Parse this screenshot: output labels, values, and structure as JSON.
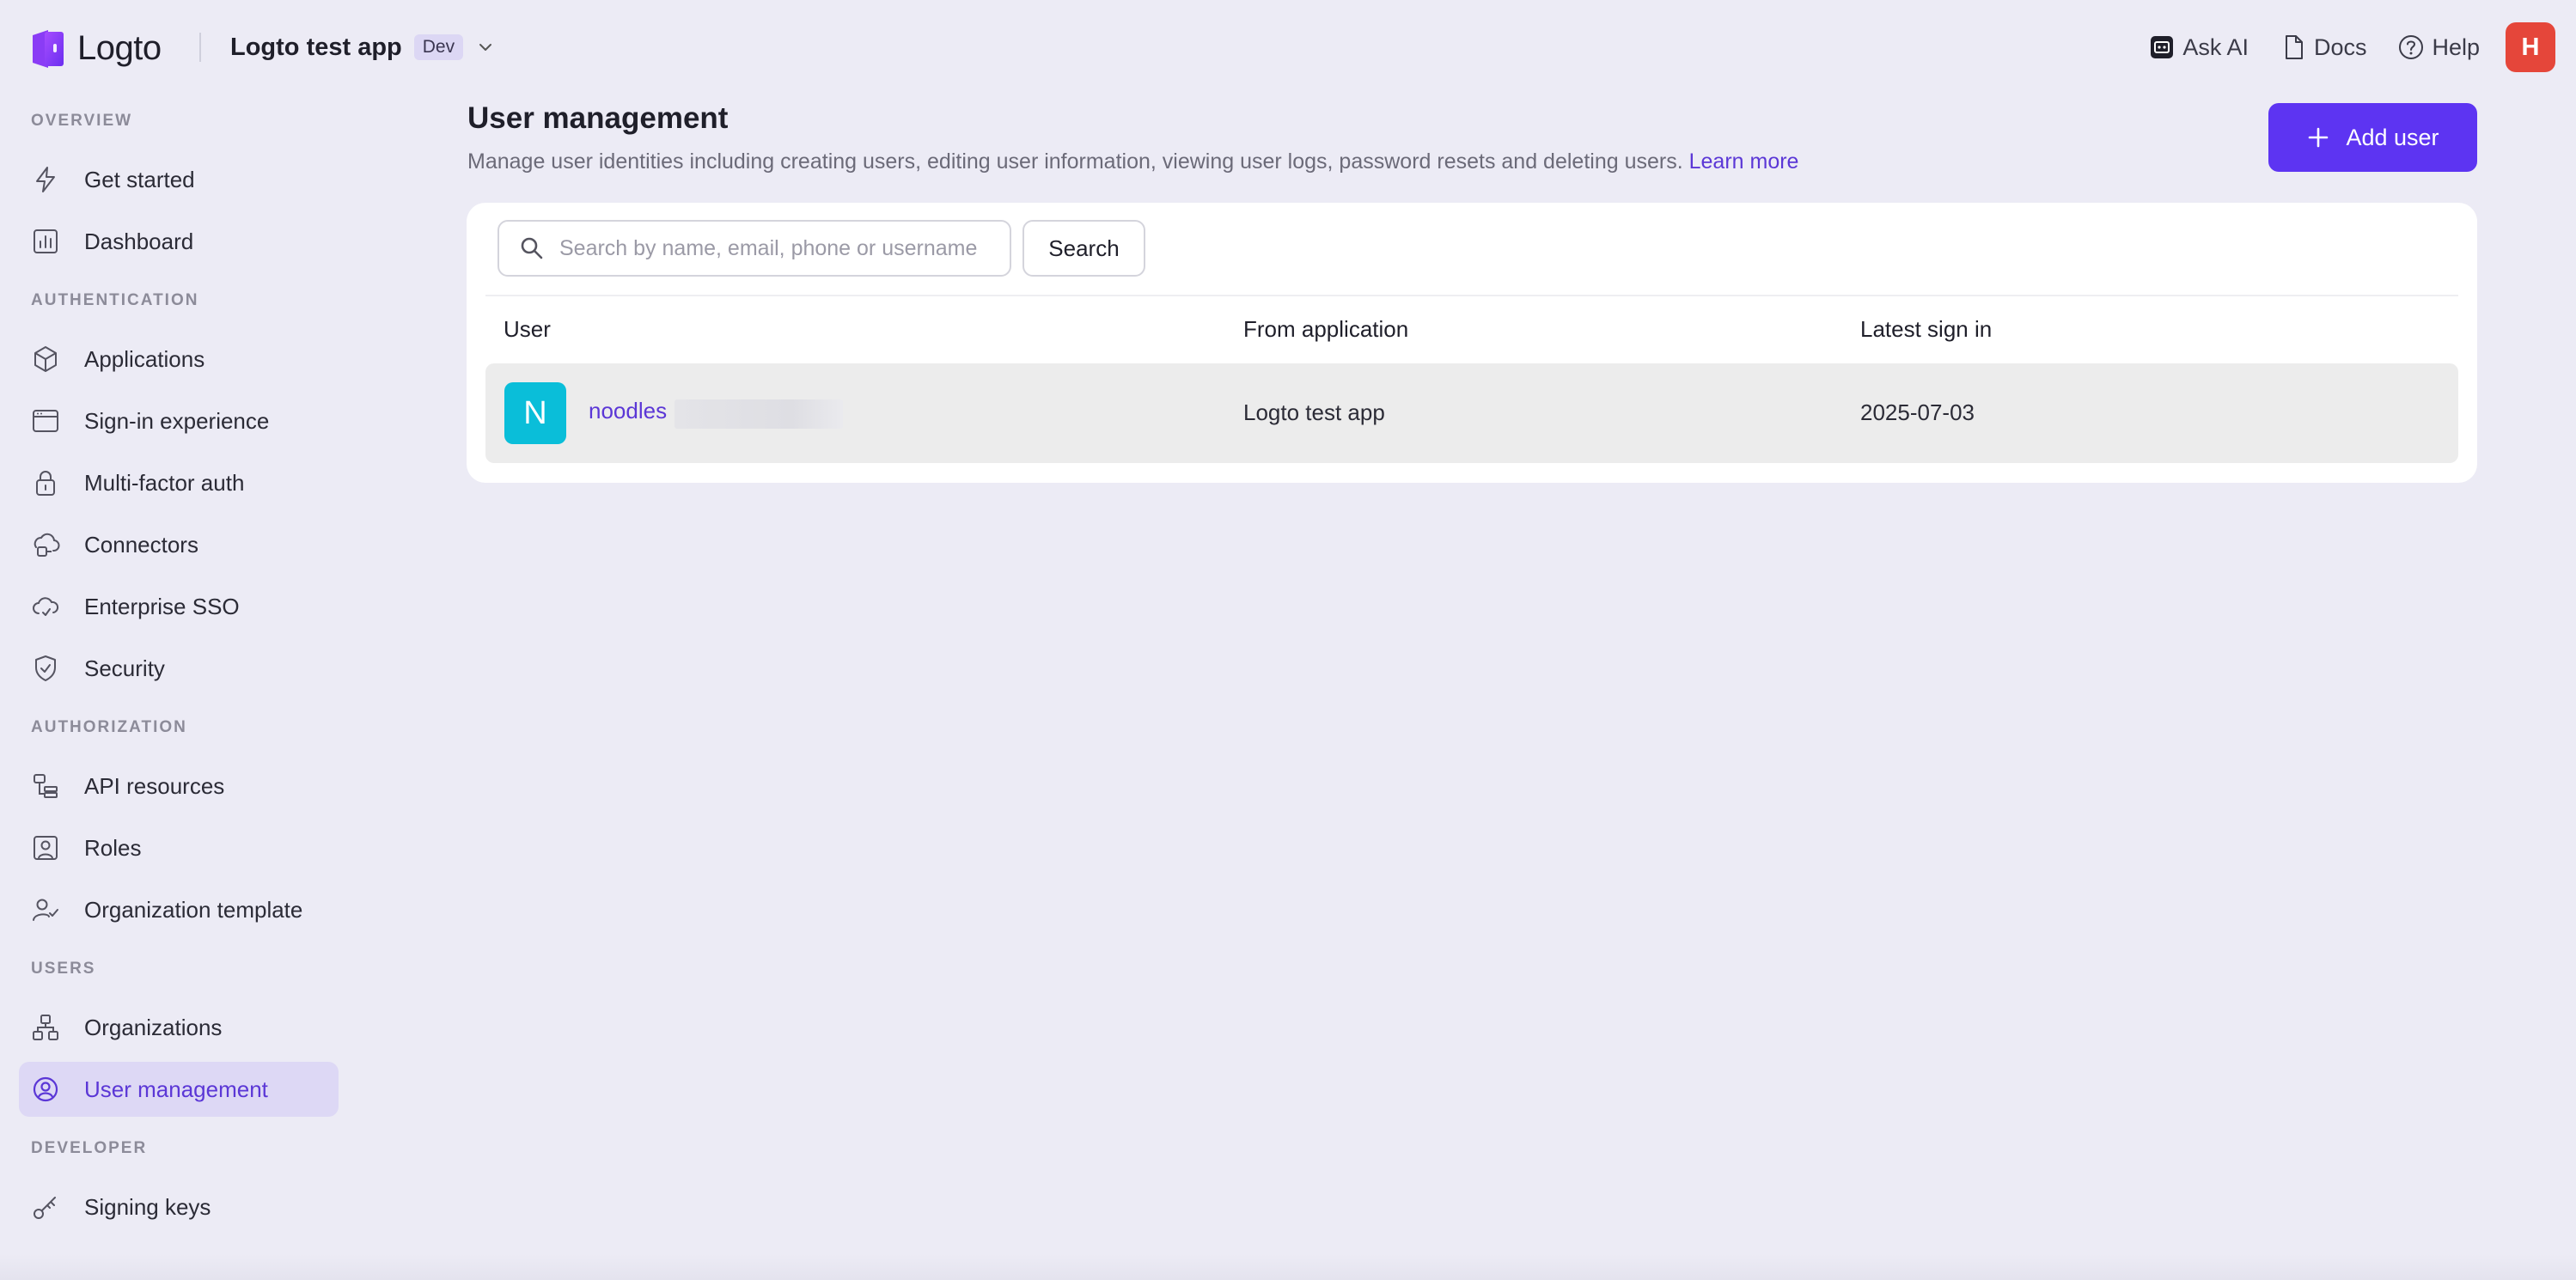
{
  "header": {
    "logo_text": "Logto",
    "app_name": "Logto test app",
    "env_badge": "Dev",
    "actions": [
      {
        "label": "Ask AI",
        "icon": "ai-icon"
      },
      {
        "label": "Docs",
        "icon": "docs-icon"
      },
      {
        "label": "Help",
        "icon": "help-icon"
      }
    ],
    "avatar_initial": "H"
  },
  "sidebar": {
    "sections": {
      "overview": "OVERVIEW",
      "authentication": "AUTHENTICATION",
      "authorization": "AUTHORIZATION",
      "users": "USERS",
      "developer": "DEVELOPER"
    },
    "items": [
      {
        "label": "Get started",
        "icon": "lightning-icon"
      },
      {
        "label": "Dashboard",
        "icon": "chart-icon"
      },
      {
        "label": "Applications",
        "icon": "cube-icon"
      },
      {
        "label": "Sign-in experience",
        "icon": "window-icon"
      },
      {
        "label": "Multi-factor auth",
        "icon": "lock-icon"
      },
      {
        "label": "Connectors",
        "icon": "connector-icon"
      },
      {
        "label": "Enterprise SSO",
        "icon": "cloud-icon"
      },
      {
        "label": "Security",
        "icon": "shield-icon"
      },
      {
        "label": "API resources",
        "icon": "api-icon"
      },
      {
        "label": "Roles",
        "icon": "role-icon"
      },
      {
        "label": "Organization template",
        "icon": "user-check-icon"
      },
      {
        "label": "Organizations",
        "icon": "org-icon"
      },
      {
        "label": "User management",
        "icon": "user-circle-icon",
        "active": true
      },
      {
        "label": "Signing keys",
        "icon": "key-icon"
      }
    ]
  },
  "main": {
    "title": "User management",
    "description": "Manage user identities including creating users, editing user information, viewing user logs, password resets and deleting users.",
    "learn_more": "Learn more",
    "add_button": "Add user",
    "search": {
      "placeholder": "Search by name, email, phone or username",
      "button": "Search"
    },
    "table": {
      "columns": [
        "User",
        "From application",
        "Latest sign in"
      ],
      "rows": [
        {
          "initial": "N",
          "name": "noodles",
          "app": "Logto test app",
          "last_sign_in": "2025-07-03"
        }
      ]
    }
  },
  "colors": {
    "accent": "#5d34f2",
    "background": "#ecebf5",
    "avatar_user": "#0abed9",
    "avatar_account": "#e5463a"
  }
}
